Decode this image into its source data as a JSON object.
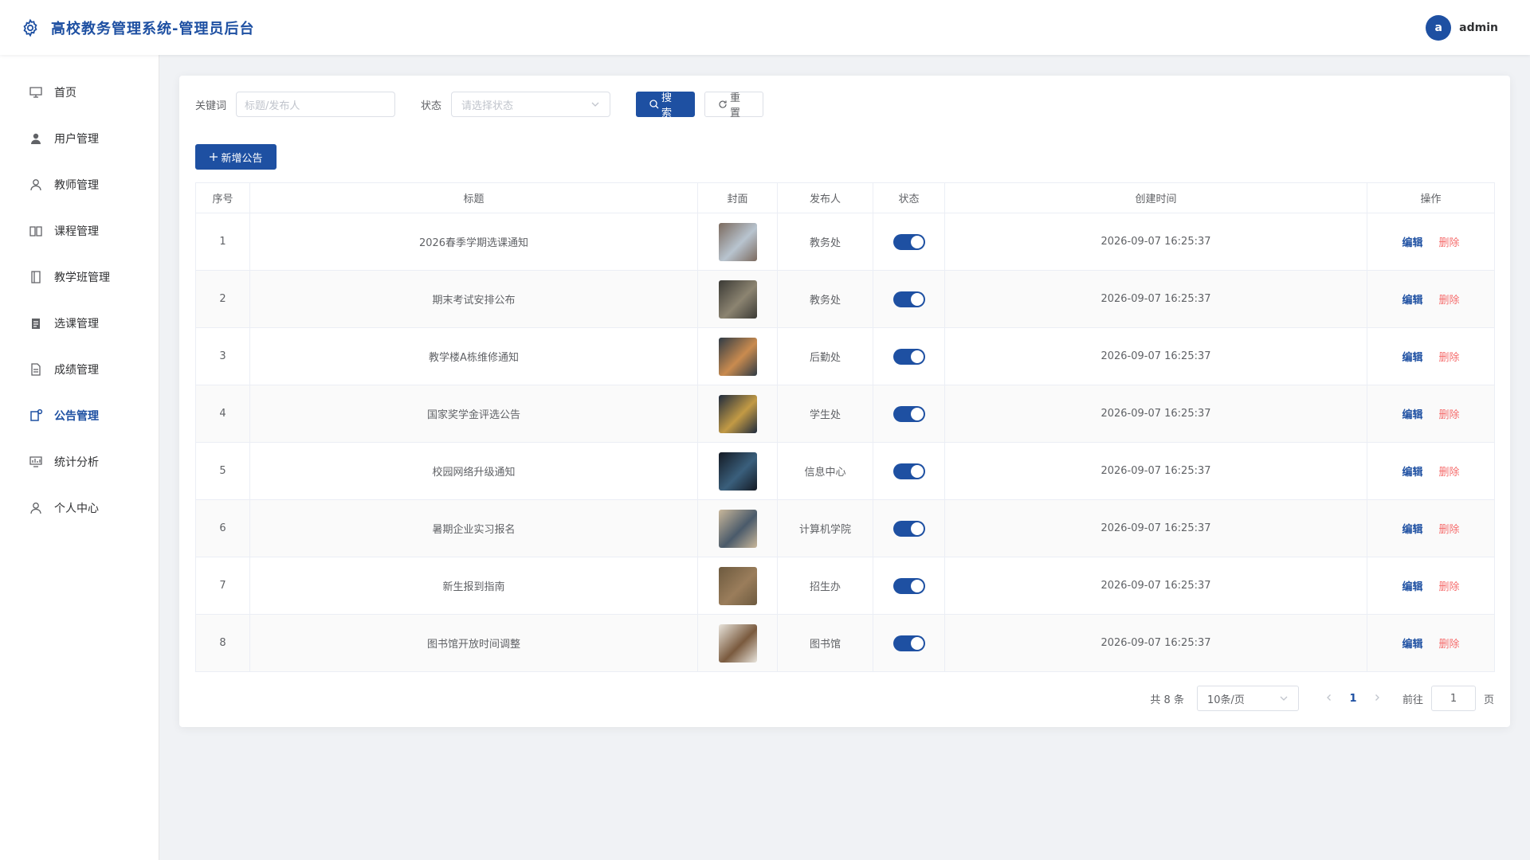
{
  "header": {
    "title": "高校教务管理系统-管理员后台",
    "avatar_letter": "a",
    "username": "admin"
  },
  "sidebar": {
    "items": [
      {
        "label": "首页",
        "icon": "dashboard-icon"
      },
      {
        "label": "用户管理",
        "icon": "user-solid-icon"
      },
      {
        "label": "教师管理",
        "icon": "user-icon"
      },
      {
        "label": "课程管理",
        "icon": "book-icon"
      },
      {
        "label": "教学班管理",
        "icon": "notebook-icon"
      },
      {
        "label": "选课管理",
        "icon": "clipboard-icon"
      },
      {
        "label": "成绩管理",
        "icon": "document-icon"
      },
      {
        "label": "公告管理",
        "icon": "notice-icon",
        "active": true
      },
      {
        "label": "统计分析",
        "icon": "chart-icon"
      },
      {
        "label": "个人中心",
        "icon": "person-icon"
      }
    ]
  },
  "filter": {
    "keyword_label": "关键词",
    "keyword_placeholder": "标题/发布人",
    "status_label": "状态",
    "status_placeholder": "请选择状态",
    "search_label": "搜索",
    "reset_label": "重置"
  },
  "add_label": "新增公告",
  "table": {
    "columns": [
      "序号",
      "标题",
      "封面",
      "发布人",
      "状态",
      "创建时间",
      "操作"
    ],
    "rows": [
      {
        "no": "1",
        "title": "2026春季学期选课通知",
        "publisher": "教务处",
        "status": true,
        "created": "2026-09-07 16:25:37",
        "cover": [
          "#7b6a5e",
          "#b8c4cf"
        ]
      },
      {
        "no": "2",
        "title": "期末考试安排公布",
        "publisher": "教务处",
        "status": true,
        "created": "2026-09-07 16:25:37",
        "cover": [
          "#3b3a35",
          "#8c8471"
        ]
      },
      {
        "no": "3",
        "title": "教学楼A栋维修通知",
        "publisher": "后勤处",
        "status": true,
        "created": "2026-09-07 16:25:37",
        "cover": [
          "#2f3b45",
          "#c98b4f"
        ]
      },
      {
        "no": "4",
        "title": "国家奖学金评选公告",
        "publisher": "学生处",
        "status": true,
        "created": "2026-09-07 16:25:37",
        "cover": [
          "#1f2b3d",
          "#c29a45"
        ]
      },
      {
        "no": "5",
        "title": "校园网络升级通知",
        "publisher": "信息中心",
        "status": true,
        "created": "2026-09-07 16:25:37",
        "cover": [
          "#141a24",
          "#3a5f7c"
        ]
      },
      {
        "no": "6",
        "title": "暑期企业实习报名",
        "publisher": "计算机学院",
        "status": true,
        "created": "2026-09-07 16:25:37",
        "cover": [
          "#c9b79a",
          "#4a5a6a"
        ]
      },
      {
        "no": "7",
        "title": "新生报到指南",
        "publisher": "招生办",
        "status": true,
        "created": "2026-09-07 16:25:37",
        "cover": [
          "#6d5a3f",
          "#9a7d5b"
        ]
      },
      {
        "no": "8",
        "title": "图书馆开放时间调整",
        "publisher": "图书馆",
        "status": true,
        "created": "2026-09-07 16:25:37",
        "cover": [
          "#e8e4dc",
          "#7a5a3e"
        ]
      }
    ],
    "edit_label": "编辑",
    "delete_label": "删除"
  },
  "pagination": {
    "total": "共 8 条",
    "page_size": "10条/页",
    "current_page": "1",
    "goto_label": "前往",
    "goto_value": "1",
    "page_unit": "页"
  },
  "colors": {
    "primary": "#1e50a2",
    "danger": "#f56c6c"
  }
}
